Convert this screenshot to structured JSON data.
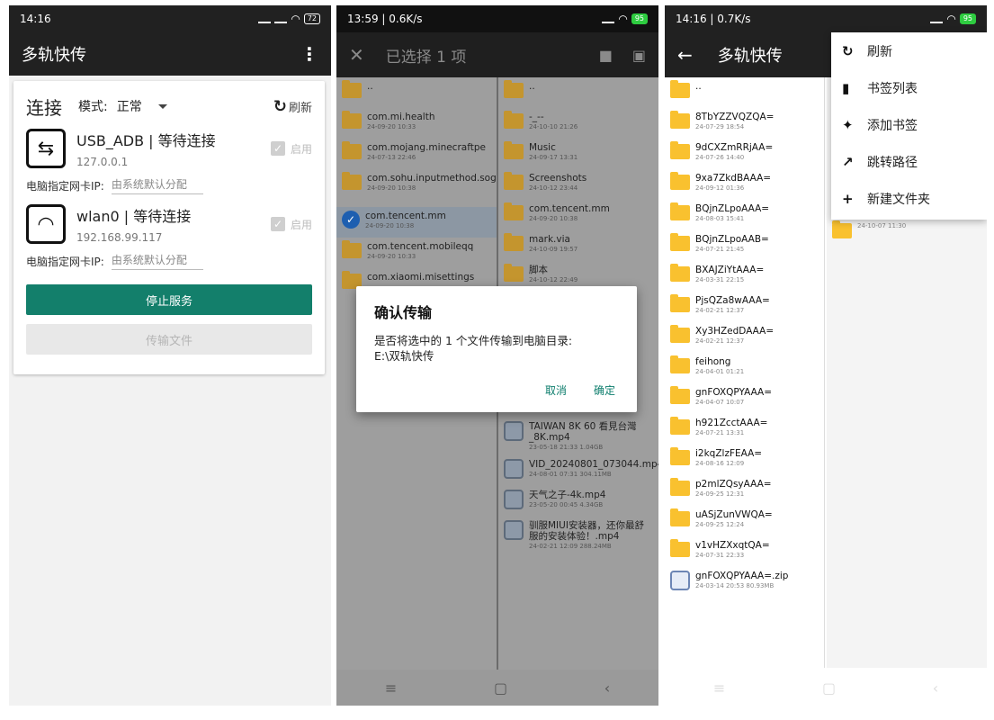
{
  "screen1": {
    "status": {
      "time": "14:16",
      "battery": "72"
    },
    "app_title": "多轨快传",
    "card": {
      "title": "连接",
      "mode_label": "模式:",
      "mode_value": "正常",
      "refresh_label": "刷新",
      "interfaces": [
        {
          "name": "USB_ADB | 等待连接",
          "addr": "127.0.0.1",
          "enable_label": "启用",
          "icon": "usb-icon"
        },
        {
          "name": "wlan0 | 等待连接",
          "addr": "192.168.99.117",
          "enable_label": "启用",
          "icon": "wifi-icon"
        }
      ],
      "ip_label": "电脑指定网卡IP:",
      "ip_placeholder": "由系统默认分配",
      "stop_button": "停止服务",
      "transfer_button": "传输文件"
    }
  },
  "screen2": {
    "status": {
      "time": "13:59 | 0.6K/s",
      "battery": "95"
    },
    "title": "已选择 1 项",
    "left_items": [
      {
        "name": "..",
        "meta": "",
        "type": "folder"
      },
      {
        "name": "com.mi.health",
        "meta": "24-09-20 10:33",
        "type": "folder"
      },
      {
        "name": "com.mojang.minecraftpe",
        "meta": "24-07-13 22:46",
        "type": "folder"
      },
      {
        "name": "com.sohu.inputmethod.sogou",
        "meta": "24-09-20 10:38",
        "type": "folder"
      },
      {
        "name": "com.tencent.mm",
        "meta": "24-09-20 10:38",
        "type": "selected"
      },
      {
        "name": "com.tencent.mobileqq",
        "meta": "24-09-20 10:33",
        "type": "folder"
      },
      {
        "name": "com.xiaomi.misettings",
        "meta": "",
        "type": "folder"
      }
    ],
    "right_items": [
      {
        "name": "..",
        "meta": "",
        "type": "folder"
      },
      {
        "name": "-_--",
        "meta": "24-10-10 21:26",
        "type": "folder"
      },
      {
        "name": "Music",
        "meta": "24-09-17 13:31",
        "type": "folder"
      },
      {
        "name": "Screenshots",
        "meta": "24-10-12 23:44",
        "type": "folder"
      },
      {
        "name": "com.tencent.mm",
        "meta": "24-09-20 10:38",
        "type": "folder"
      },
      {
        "name": "mark.via",
        "meta": "24-10-09 19:57",
        "type": "folder"
      },
      {
        "name": "脚本",
        "meta": "24-10-12 22:49",
        "type": "folder"
      }
    ],
    "right_files": [
      {
        "name": "TAIWAN 8K 60 看見台灣 _8K.mp4",
        "meta": "23-05-18 21:33 1.04GB"
      },
      {
        "name": "VID_20240801_073044.mp4",
        "meta": "24-08-01 07:31 304.11MB"
      },
      {
        "name": "天气之子-4k.mp4",
        "meta": "23-05-20 00:45 4.34GB"
      },
      {
        "name": "驯服MIUI安装器，还你最舒服的安装体验！.mp4",
        "meta": "24-02-21 12:09 288.24MB"
      }
    ],
    "dialog": {
      "title": "确认传输",
      "body": "是否将选中的 1 个文件传输到电脑目录:",
      "path": "E:\\双轨快传",
      "cancel": "取消",
      "ok": "确定"
    }
  },
  "screen3": {
    "status": {
      "time": "14:16 | 0.7K/s",
      "battery": "95"
    },
    "title": "多轨快传",
    "items": [
      {
        "name": "..",
        "meta": ""
      },
      {
        "name": "8TbYZZVQZQA=",
        "meta": "24-07-29 18:54"
      },
      {
        "name": "9dCXZmRRjAA=",
        "meta": "24-07-26 14:40"
      },
      {
        "name": "9xa7ZkdBAAA=",
        "meta": "24-09-12 01:36"
      },
      {
        "name": "BQjnZLpoAAA=",
        "meta": "24-08-03 15:41"
      },
      {
        "name": "BQjnZLpoAAB=",
        "meta": "24-07-21 21:45"
      },
      {
        "name": "BXAJZiYtAAA=",
        "meta": "24-03-31 22:15"
      },
      {
        "name": "PjsQZa8wAAA=",
        "meta": "24-02-21 12:37"
      },
      {
        "name": "Xy3HZedDAAA=",
        "meta": "24-02-21 12:37"
      },
      {
        "name": "feihong",
        "meta": "24-04-01 01:21"
      },
      {
        "name": "gnFOXQPYAAA=",
        "meta": "24-04-07 10:07"
      },
      {
        "name": "h921ZcctAAA=",
        "meta": "24-07-21 13:31"
      },
      {
        "name": "i2kqZlzFEAA=",
        "meta": "24-08-16 12:09"
      },
      {
        "name": "p2mlZQsyAAA=",
        "meta": "24-09-25 12:31"
      },
      {
        "name": "uASjZunVWQA=",
        "meta": "24-09-25 12:24"
      },
      {
        "name": "v1vHZXxqtQA=",
        "meta": "24-07-31 22:33"
      }
    ],
    "zip": {
      "name": "gnFOXQPYAAA=.zip",
      "meta": "24-03-14 20:53 80.93MB"
    },
    "menu": [
      "刷新",
      "书签列表",
      "添加书签",
      "跳转路径",
      "新建文件夹"
    ],
    "partial_meta": "24-10-07 11:30"
  }
}
